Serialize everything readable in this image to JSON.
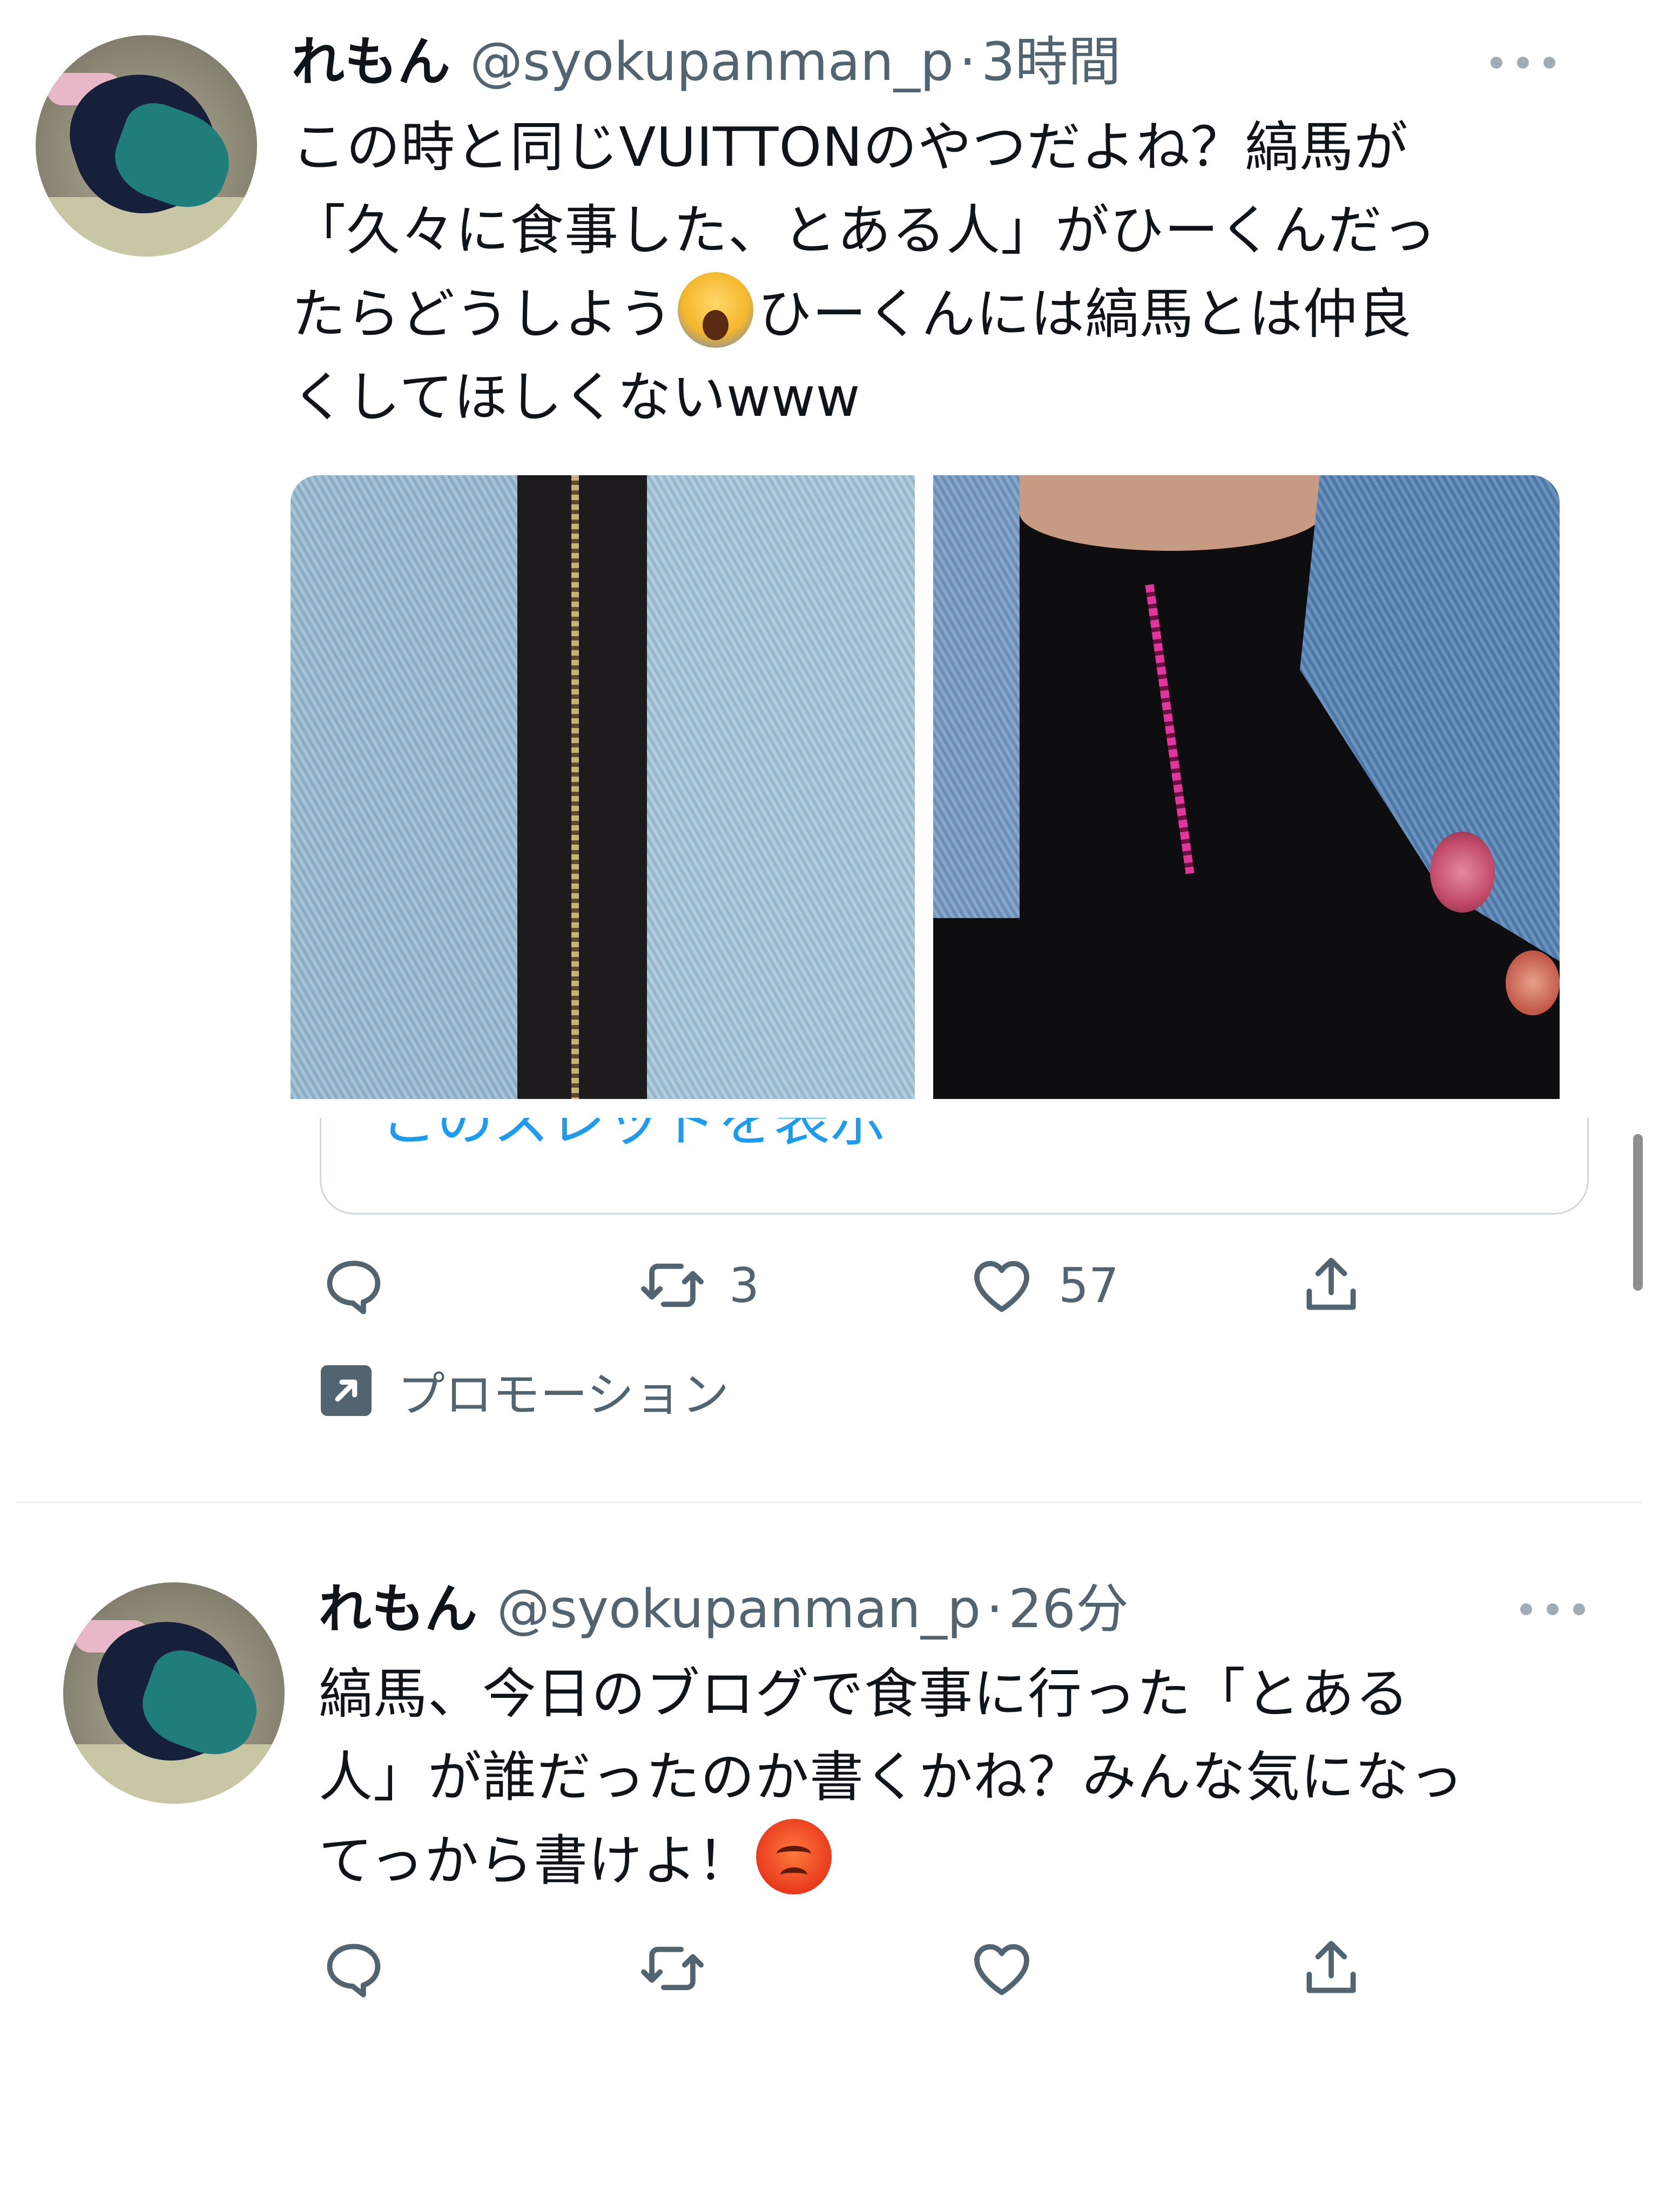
{
  "tweets": [
    {
      "display_name": "れもん",
      "handle": "@syokupanman_p",
      "separator": "·",
      "time": "3時間",
      "text_lines": [
        "この時と同じVUITTONのやつだよね？縞馬が",
        "「久々に食事した、とある人」がひーくんだっ",
        "たらどうしよう",
        "ひーくんには縞馬とは仲良",
        "くしてほしくないwww"
      ],
      "media": [
        "denim-jacket-photo-left",
        "denim-jacket-photo-right"
      ],
      "quote_link": "このスレッドを表示",
      "actions": {
        "reply_count": "",
        "retweet_count": "3",
        "like_count": "57"
      },
      "promo_label": "プロモーション"
    },
    {
      "display_name": "れもん",
      "handle": "@syokupanman_p",
      "separator": "·",
      "time": "26分",
      "text_lines": [
        "縞馬、今日のブログで食事に行った「とある",
        "人」が誰だったのか書くかね？みんな気になっ",
        "てっから書けよ！"
      ],
      "actions": {
        "reply_count": "",
        "retweet_count": "",
        "like_count": ""
      }
    }
  ],
  "icons": {
    "reply": "reply-icon",
    "retweet": "retweet-icon",
    "like": "heart-icon",
    "share": "share-icon",
    "more": "more-dots-icon",
    "promo": "promoted-arrow-icon",
    "emoji_1": "face-screaming-emoji",
    "emoji_2": "angry-face-emoji"
  },
  "colors": {
    "text": "#0f1419",
    "secondary": "#536471",
    "link": "#1d9bf0",
    "divider": "#eff3f4"
  }
}
